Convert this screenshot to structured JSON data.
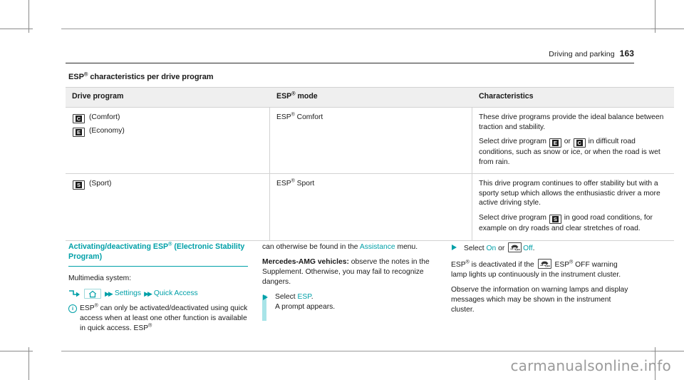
{
  "header": {
    "section_title": "Driving and parking",
    "page_number": "163"
  },
  "table": {
    "caption_pre": "ESP",
    "caption_sup": "®",
    "caption_post": " characteristics per drive program",
    "columns": [
      {
        "label_pre": "Drive program",
        "label_sup": "",
        "label_post": ""
      },
      {
        "label_pre": "ESP",
        "label_sup": "®",
        "label_post": " mode"
      },
      {
        "label_pre": "Characteristics",
        "label_sup": "",
        "label_post": ""
      }
    ],
    "rows": [
      {
        "programs": [
          {
            "icon": "drive-program-comfort-badge",
            "letter": "C",
            "label": "(Comfort)"
          },
          {
            "icon": "drive-program-economy-badge",
            "letter": "E",
            "label": "(Economy)"
          }
        ],
        "mode_pre": "ESP",
        "mode_sup": "®",
        "mode_post": " Comfort",
        "char_p1": "These drive programs provide the ideal balance between traction and stability.",
        "char_p2_a": "Select drive program ",
        "char_p2_icon1_letter": "E",
        "char_p2_b": " or ",
        "char_p2_icon2_letter": "C",
        "char_p2_c": " in difficult road conditions, such as snow or ice, or when the road is wet from rain."
      },
      {
        "programs": [
          {
            "icon": "drive-program-sport-badge",
            "letter": "S",
            "label": "(Sport)"
          }
        ],
        "mode_pre": "ESP",
        "mode_sup": "®",
        "mode_post": " Sport",
        "char_p1": "This drive program continues to offer stability but with a sporty setup which allows the enthusiastic driver a more active driving style.",
        "char_p2_a": "Select drive program ",
        "char_p2_icon1_letter": "S",
        "char_p2_b": "",
        "char_p2_icon2_letter": "",
        "char_p2_c": " in good road conditions, for example on dry roads and clear stretches of road."
      }
    ]
  },
  "left_column": {
    "section_title_pre": "Activating/deactivating ESP",
    "section_title_sup": "®",
    "section_title_post": " (Electronic Stability Program)",
    "multimedia_label": "Multimedia system:",
    "menu_path": {
      "home_icon": "home-icon",
      "separator": "▶▶",
      "item1": "Settings",
      "item2": "Quick Access"
    },
    "note_text_a": "ESP",
    "note_sup": "®",
    "note_text_b": " can only be activated/deactivated using quick access when at least one other function is available in quick access. ESP",
    "note_sup2": "®"
  },
  "middle_column": {
    "cont_text": "can otherwise be found in the ",
    "cont_link": "Assistance",
    "cont_text_after": " menu.",
    "amg_label": "Mercedes-AMG vehicles:",
    "amg_text": " observe the notes in the Supplement. Otherwise, you may fail to recognize dangers.",
    "step_pre": "Select ",
    "step_link": "ESP",
    "step_post": ".",
    "step_result": "A prompt appears."
  },
  "right_column": {
    "step_pre": "Select ",
    "step_on": "On",
    "step_mid": " or ",
    "step_lamp_icon": "esp-off-warning-lamp-icon",
    "step_off": "Off",
    "step_post": ".",
    "p1_a": "ESP",
    "p1_sup": "®",
    "p1_b": " is deactivated if the ",
    "p1_c": " ESP",
    "p1_sup2": "®",
    "p1_d": " OFF warning lamp lights up continuously in the instrument cluster.",
    "p2": "Observe the information on warning lamps and display messages which may be shown in the instrument cluster."
  },
  "watermark": "carmanualsonline.info",
  "colors": {
    "teal": "#00a0a8",
    "teal_light": "#a8e4e8",
    "table_header_bg": "#efefef",
    "rule": "#d2d2d2"
  }
}
